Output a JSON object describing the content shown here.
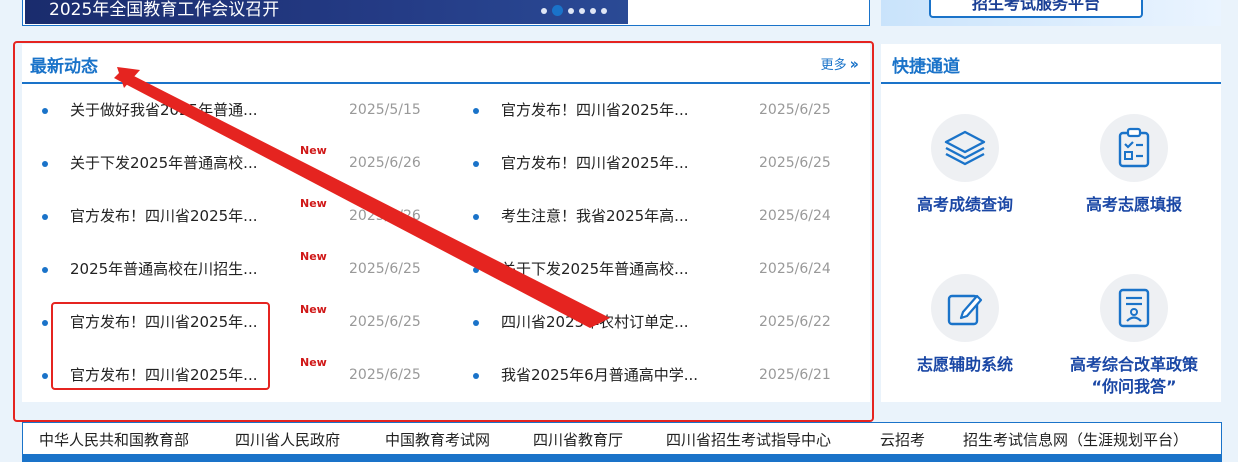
{
  "banner": {
    "title": "2025年全国教育工作会议召开",
    "promo_text": "招生考试服务平台"
  },
  "news": {
    "title": "最新动态",
    "more_label": "更多",
    "badge_text": "New",
    "left": [
      {
        "title": "关于做好我省2025年普通...",
        "date": "2025/5/15",
        "new": false
      },
      {
        "title": "关于下发2025年普通高校...",
        "date": "2025/6/26",
        "new": true
      },
      {
        "title": "官方发布！四川省2025年...",
        "date": "2025/6/26",
        "new": true
      },
      {
        "title": "2025年普通高校在川招生...",
        "date": "2025/6/25",
        "new": true
      },
      {
        "title": "官方发布！四川省2025年...",
        "date": "2025/6/25",
        "new": true
      },
      {
        "title": "官方发布！四川省2025年...",
        "date": "2025/6/25",
        "new": true
      }
    ],
    "right": [
      {
        "title": "官方发布！四川省2025年...",
        "date": "2025/6/25"
      },
      {
        "title": "官方发布！四川省2025年...",
        "date": "2025/6/25"
      },
      {
        "title": "考生注意！我省2025年高...",
        "date": "2025/6/24"
      },
      {
        "title": "关于下发2025年普通高校...",
        "date": "2025/6/24"
      },
      {
        "title": "四川省2025年农村订单定...",
        "date": "2025/6/22"
      },
      {
        "title": "我省2025年6月普通高中学...",
        "date": "2025/6/21"
      }
    ]
  },
  "quick": {
    "title": "快捷通道",
    "items": [
      {
        "label": "高考成绩查询",
        "icon": "layers-icon"
      },
      {
        "label": "高考志愿填报",
        "icon": "clipboard-checklist-icon"
      },
      {
        "label": "志愿辅助系统",
        "icon": "edit-icon"
      },
      {
        "label_line1": "高考综合改革政策",
        "label_line2": "“你问我答”",
        "icon": "policy-document-icon"
      }
    ]
  },
  "links": [
    "中华人民共和国教育部",
    "四川省人民政府",
    "中国教育考试网",
    "四川省教育厅",
    "四川省招生考试指导中心",
    "云招考",
    "招生考试信息网（生涯规划平台）"
  ],
  "colors": {
    "accent": "#1a73c9",
    "new_badge": "#d01818",
    "annotation": "#e52420"
  }
}
